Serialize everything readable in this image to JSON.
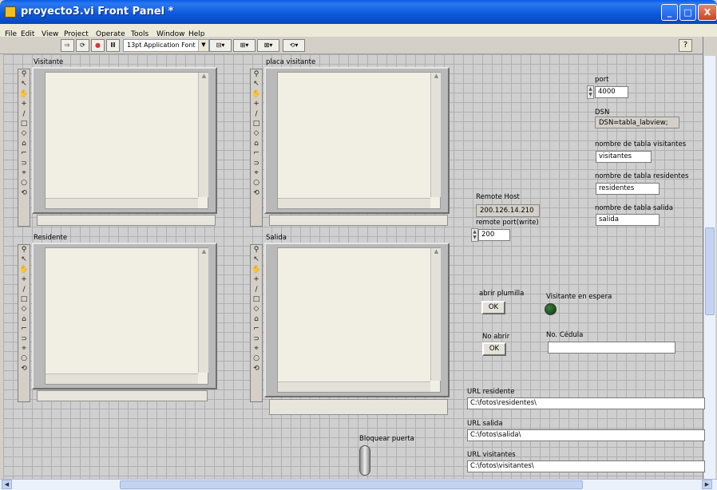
{
  "window": {
    "title": "proyecto3.vi Front Panel *",
    "controls": [
      "_",
      "□",
      "X"
    ]
  },
  "menu": [
    "File",
    "Edit",
    "View",
    "Project",
    "Operate",
    "Tools",
    "Window",
    "Help"
  ],
  "toolbar": {
    "run": "⇨",
    "run_continuous": "⟳",
    "abort": "●",
    "pause": "II",
    "font": "13pt Application Font",
    "align": "⊟▾",
    "distribute": "⊞▾",
    "resize": "⊠▾",
    "reorder": "⟲▾",
    "help": "?"
  },
  "picture_tools": [
    "⚲",
    "↖",
    "✋",
    "+",
    "/",
    "□",
    "◇",
    "⌂",
    "⌐",
    "⊃",
    "⌖",
    "○",
    "⟲"
  ],
  "pictures": {
    "visitante": "Visitante",
    "placa": "placa visitante",
    "residente": "Residente",
    "salida": "Salida"
  },
  "network": {
    "remote_host_label": "Remote Host",
    "remote_host": "200.126.14.210",
    "remote_port_label": "remote port(write)",
    "remote_port": "200",
    "port_label": "port",
    "port": "4000"
  },
  "db": {
    "dsn_label": "DSN",
    "dsn": "DSN=tabla_labview;",
    "visitantes_label": "nombre de tabla visitantes",
    "visitantes": "visitantes",
    "residentes_label": "nombre de tabla residentes",
    "residentes": "residentes",
    "salida_label": "nombre de tabla salida",
    "salida": "salida"
  },
  "controls": {
    "abrir_label": "abrir plumilla",
    "ok": "OK",
    "no_abrir_label": "No abrir",
    "espera_label": "Visitante en espera",
    "cedula_label": "No. Cédula",
    "cedula": "",
    "bloquear_label": "Bloquear puerta"
  },
  "urls": {
    "residente_label": "URL residente",
    "residente": "C:\\fotos\\residentes\\",
    "salida_label": "URL salida",
    "salida": "C:\\fotos\\salida\\",
    "visitantes_label": "URL visitantes",
    "visitantes": "C:\\fotos\\visitantes\\"
  },
  "colors": {
    "titlebar": "#0b57dc",
    "led_off": "#0b3d0b",
    "panel_grid": "#cfcfcf"
  }
}
